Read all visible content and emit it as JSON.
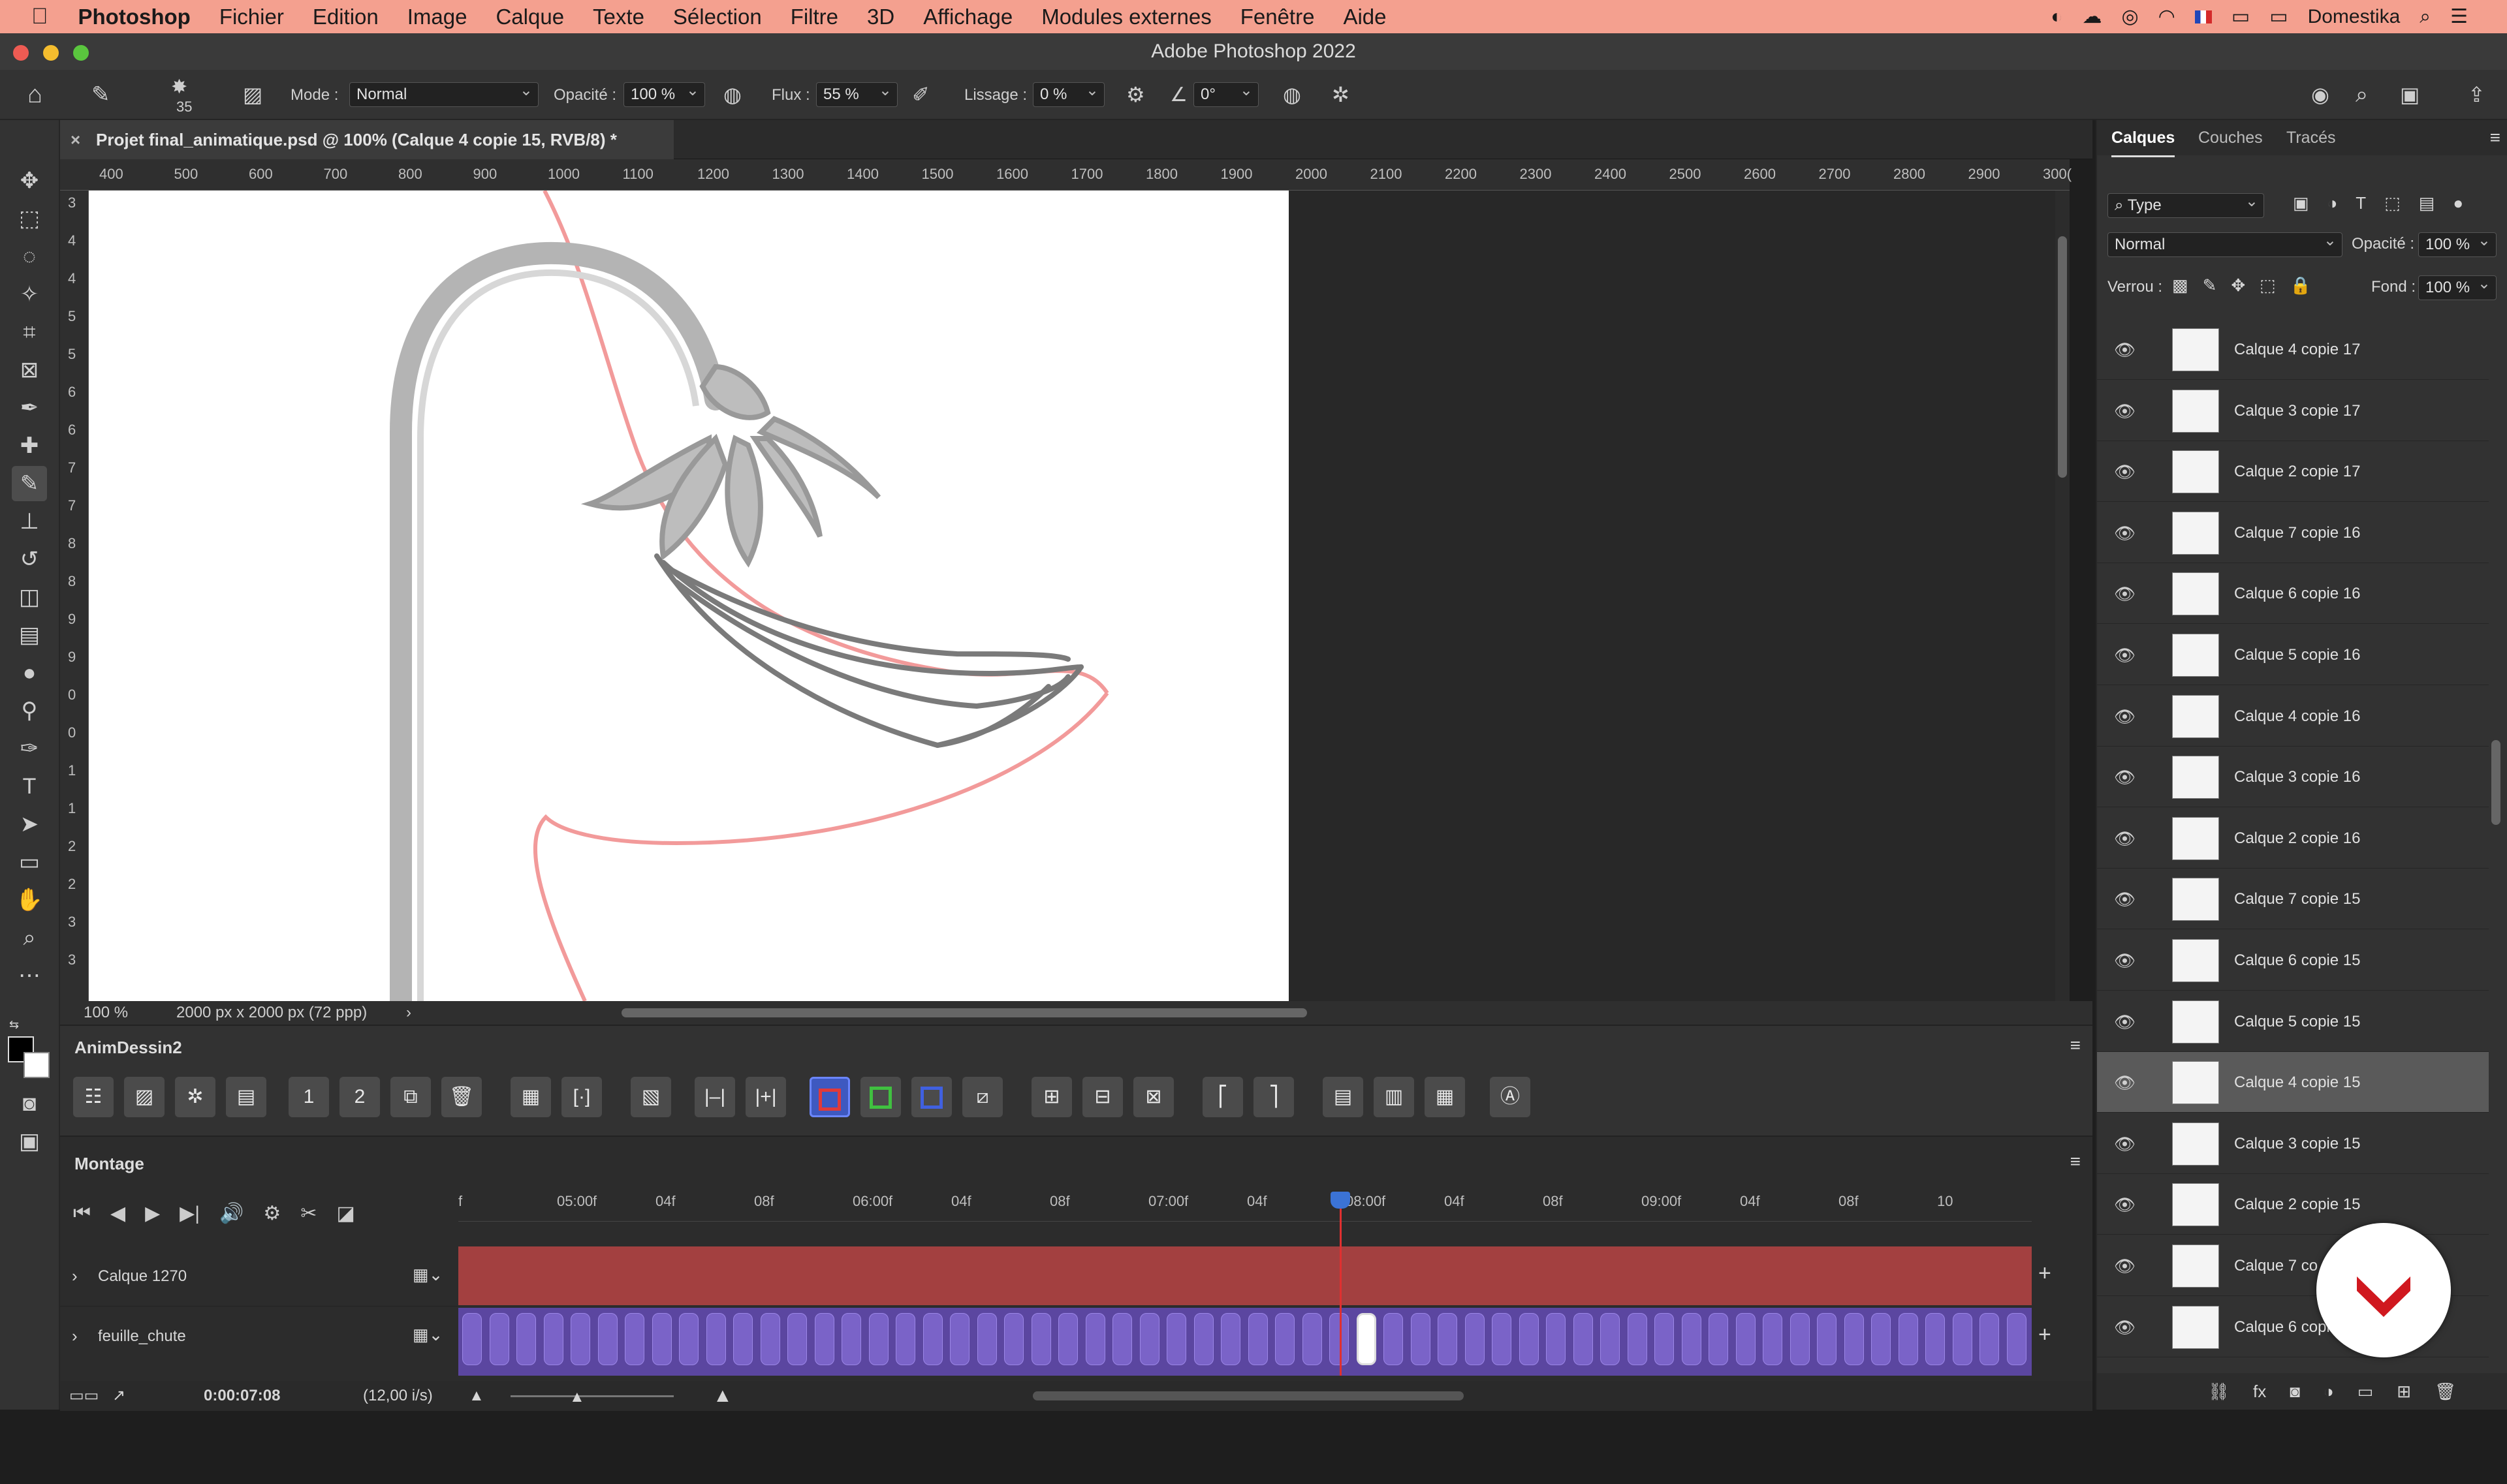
{
  "menubar": {
    "app_name": "Photoshop",
    "items": [
      "Fichier",
      "Edition",
      "Image",
      "Calque",
      "Texte",
      "Sélection",
      "Filtre",
      "3D",
      "Affichage",
      "Modules externes",
      "Fenêtre",
      "Aide"
    ],
    "user": "Domestika"
  },
  "window": {
    "title": "Adobe Photoshop 2022"
  },
  "options": {
    "brush_size": "35",
    "mode_label": "Mode :",
    "mode_value": "Normal",
    "opacity_label": "Opacité :",
    "opacity_value": "100 %",
    "flow_label": "Flux :",
    "flow_value": "55 %",
    "smoothing_label": "Lissage :",
    "smoothing_value": "0 %",
    "angle_value": "0°"
  },
  "document": {
    "tab_title": "Projet final_animatique.psd @ 100% (Calque 4 copie 15, RVB/8) *",
    "ruler_ticks": [
      "400",
      "500",
      "600",
      "700",
      "800",
      "900",
      "1000",
      "1100",
      "1200",
      "1300",
      "1400",
      "1500",
      "1600",
      "1700",
      "1800",
      "1900",
      "2000",
      "2100",
      "2200",
      "2300",
      "2400",
      "2500",
      "2600",
      "2700",
      "2800",
      "2900",
      "300("
    ],
    "ruler_left_ticks": [
      "3",
      "4",
      "4",
      "5",
      "5",
      "6",
      "6",
      "7",
      "7",
      "8",
      "8",
      "9",
      "9",
      "0",
      "0",
      "1",
      "1",
      "2",
      "2",
      "3",
      "3"
    ],
    "zoom": "100 %",
    "doc_size": "2000 px x 2000 px (72 ppp)"
  },
  "anim_panel": {
    "title": "AnimDessin2"
  },
  "montage": {
    "title": "Montage",
    "ruler_labels": [
      "f",
      "05:00f",
      "04f",
      "08f",
      "06:00f",
      "04f",
      "08f",
      "07:00f",
      "04f",
      "08:00f",
      "04f",
      "08f",
      "09:00f",
      "04f",
      "08f",
      "10"
    ],
    "tracks": [
      {
        "name": "Calque 1270",
        "color": "#a34040"
      },
      {
        "name": "feuille_chute",
        "color": "#6a4fb0"
      }
    ],
    "timecode": "0:00:07:08",
    "fps": "(12,00 i/s)"
  },
  "layers_panel": {
    "tabs": [
      "Calques",
      "Couches",
      "Tracés"
    ],
    "filter_value": "Type",
    "blend_mode": "Normal",
    "opacity_label": "Opacité :",
    "opacity_value": "100 %",
    "lock_label": "Verrou :",
    "fill_label": "Fond :",
    "fill_value": "100 %",
    "layers": [
      {
        "name": "Calque 4 copie 17",
        "selected": false
      },
      {
        "name": "Calque 3 copie 17",
        "selected": false
      },
      {
        "name": "Calque 2 copie 17",
        "selected": false
      },
      {
        "name": "Calque 7 copie 16",
        "selected": false
      },
      {
        "name": "Calque 6 copie 16",
        "selected": false
      },
      {
        "name": "Calque 5 copie 16",
        "selected": false
      },
      {
        "name": "Calque 4 copie 16",
        "selected": false
      },
      {
        "name": "Calque 3 copie 16",
        "selected": false
      },
      {
        "name": "Calque 2 copie 16",
        "selected": false
      },
      {
        "name": "Calque 7 copie 15",
        "selected": false
      },
      {
        "name": "Calque 6 copie 15",
        "selected": false
      },
      {
        "name": "Calque 5 copie 15",
        "selected": false
      },
      {
        "name": "Calque 4 copie 15",
        "selected": true
      },
      {
        "name": "Calque 3 copie 15",
        "selected": false
      },
      {
        "name": "Calque 2 copie 15",
        "selected": false
      },
      {
        "name": "Calque 7 co",
        "selected": false
      },
      {
        "name": "Calque 6 copi",
        "selected": false
      }
    ]
  },
  "colors": {
    "menubar": "#f4a08f",
    "accent": "#1473e6",
    "playhead": "#e03030",
    "badge": "#d0181f"
  }
}
